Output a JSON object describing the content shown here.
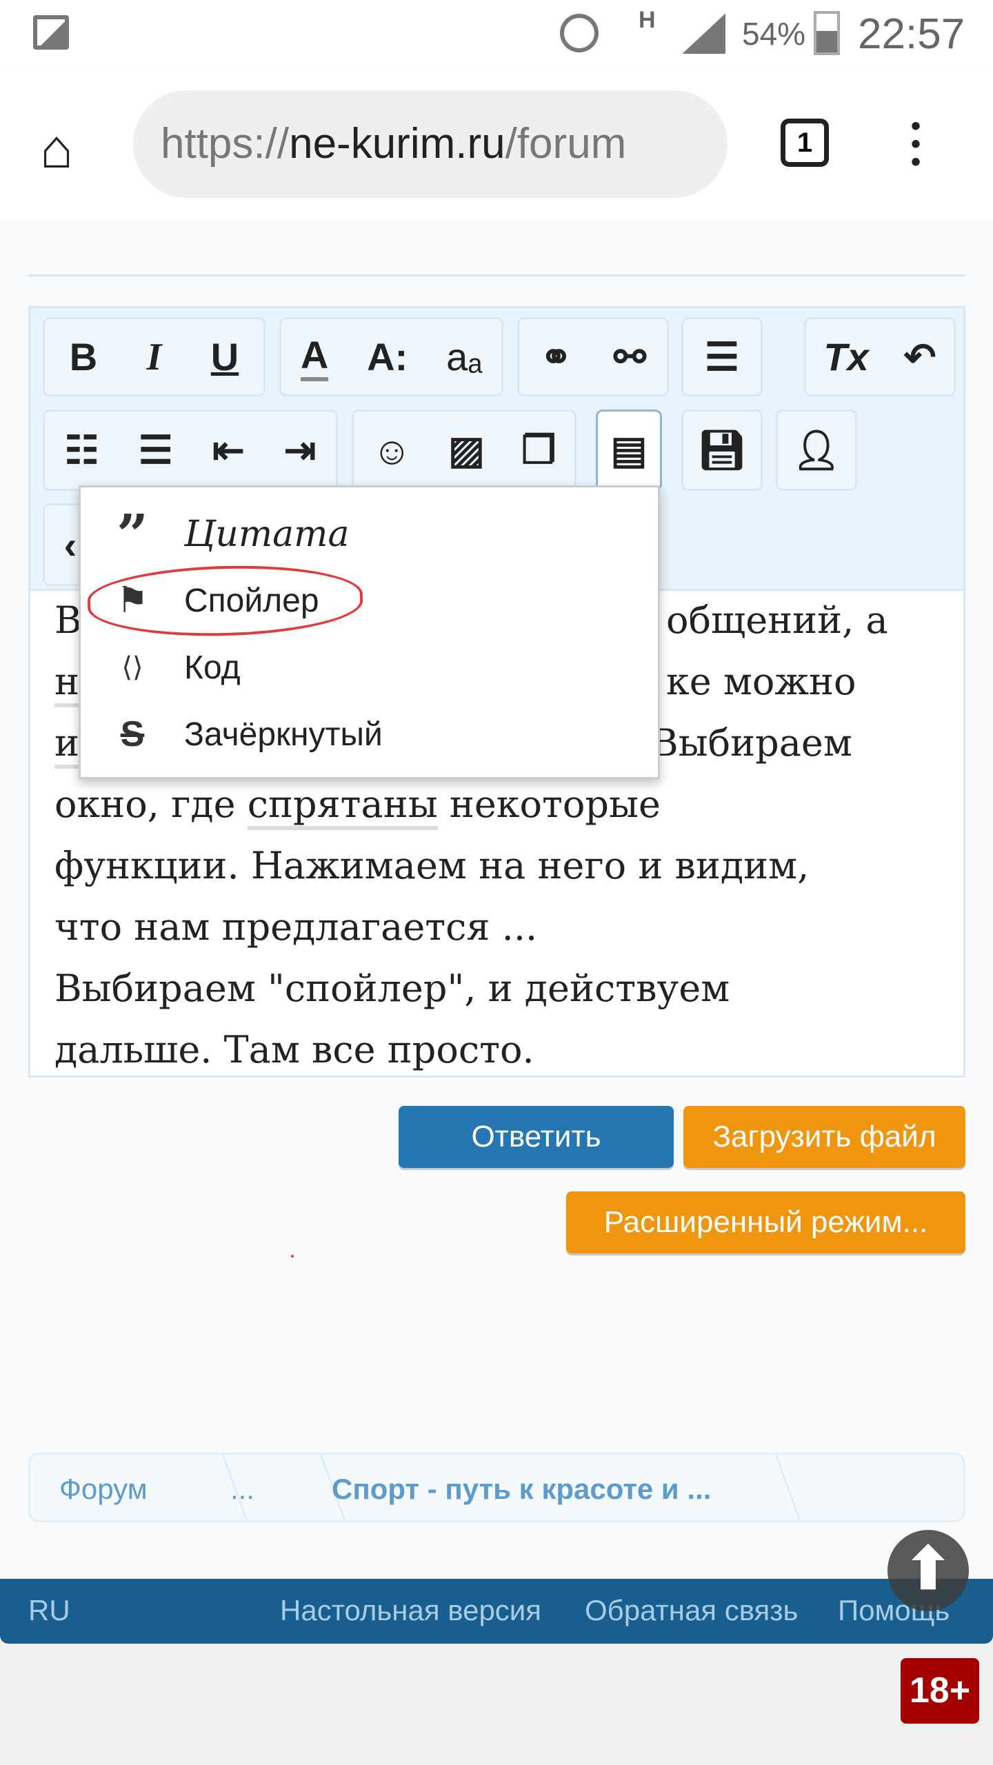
{
  "status_bar": {
    "battery": "54%",
    "time": "22:57",
    "network": "H"
  },
  "browser": {
    "url_scheme": "https://",
    "url_host": "ne-kurim.ru",
    "url_path": "/forum",
    "tab_count": "1"
  },
  "toolbar": {
    "row1": [
      [
        "B",
        "I",
        "U"
      ],
      [
        "A",
        "A:",
        "aₐ"
      ],
      [
        "link",
        "unlink"
      ],
      [
        "align"
      ],
      [
        "Tx",
        "undo"
      ]
    ]
  },
  "dropdown": {
    "items": [
      {
        "label": "Цитата",
        "icon": "quote-icon"
      },
      {
        "label": "Спойлер",
        "icon": "flag-icon"
      },
      {
        "label": "Код",
        "icon": "code-file-icon"
      },
      {
        "label": "Зачёркнутый",
        "icon": "strikethrough-icon"
      }
    ]
  },
  "editor": {
    "lines": [
      {
        "left": "В",
        "right": "общений, а"
      },
      {
        "left": "н",
        "right": "ке можно"
      },
      {
        "left": "и",
        "right": "Выбираем"
      },
      {
        "a": "окно, где ",
        "u": "спрятаны",
        "b": " некоторые"
      },
      {
        "text": "функции. Нажимаем на него и видим,"
      },
      {
        "text": "что нам предлагается ..."
      },
      {
        "text": "Выбираем \"спойлер\", и действуем"
      },
      {
        "text": "дальше. Там все просто."
      }
    ]
  },
  "buttons": {
    "reply": "Ответить",
    "upload": "Загрузить файл",
    "advanced": "Расширенный режим..."
  },
  "breadcrumb": [
    "Форум",
    "...",
    "Спорт - путь к красоте и ..."
  ],
  "footer": {
    "lang": "RU",
    "links": [
      "Настольная версия",
      "Обратная связь",
      "Помощь"
    ]
  },
  "age_badge": "18+",
  "colors": {
    "reply": "#2577b1",
    "orange": "#f0950e",
    "footer": "#185f8f",
    "badge": "#a50000",
    "annotation": "#e03c3c"
  }
}
